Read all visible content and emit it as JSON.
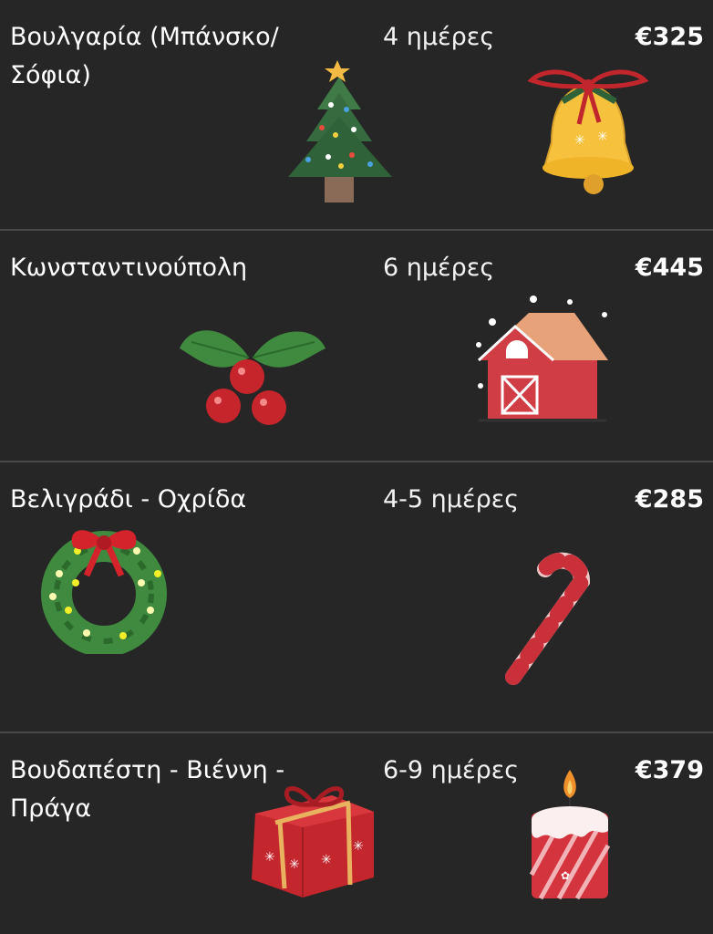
{
  "trips": [
    {
      "destination": "Βουλγαρία (Μπάνσκο/ Σόφια)",
      "duration": "4 ημέρες",
      "price": "€325"
    },
    {
      "destination": "Κωνσταντινούπολη",
      "duration": "6 ημέρες",
      "price": "€445"
    },
    {
      "destination": "Βελιγράδι - Οχρίδα",
      "duration": "4-5 ημέρες",
      "price": "€285"
    },
    {
      "destination": "Βουδαπέστη - Βιέννη - Πράγα",
      "duration": "6-9 ημέρες",
      "price": "€379"
    }
  ],
  "decorations": [
    [
      "christmas-tree-icon",
      "bell-icon"
    ],
    [
      "holly-icon",
      "house-icon"
    ],
    [
      "wreath-icon",
      "candy-cane-icon"
    ],
    [
      "gift-icon",
      "candle-icon"
    ]
  ],
  "colors": {
    "background": "#262626",
    "divider": "#47494b",
    "text": "#ffffff"
  }
}
